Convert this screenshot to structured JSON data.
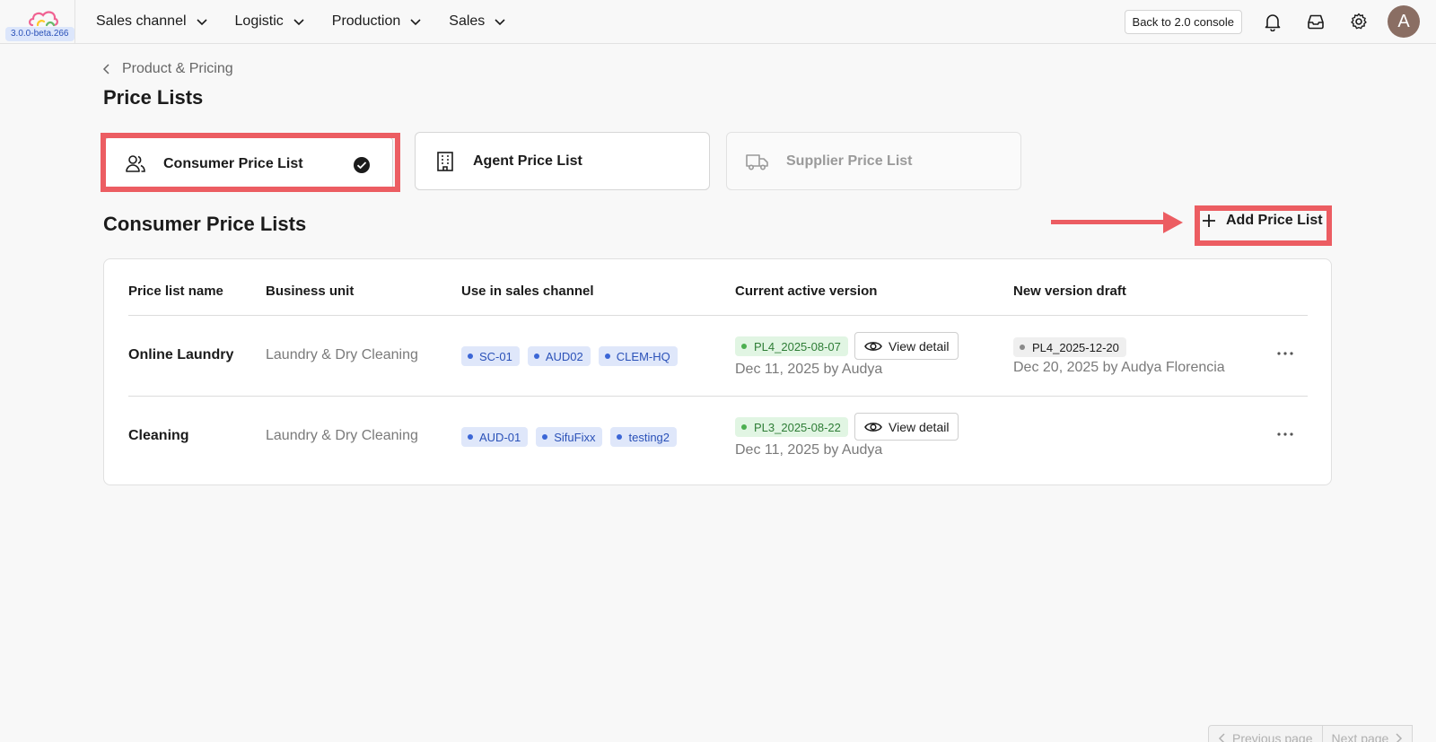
{
  "app": {
    "version": "3.0.0-beta.266"
  },
  "nav": {
    "items": [
      {
        "label": "Sales channel"
      },
      {
        "label": "Logistic"
      },
      {
        "label": "Production"
      },
      {
        "label": "Sales"
      }
    ]
  },
  "topbar": {
    "back_label": "Back to 2.0 console",
    "avatar_initial": "A"
  },
  "breadcrumb": {
    "parent": "Product & Pricing"
  },
  "page": {
    "title": "Price Lists"
  },
  "price_types": [
    {
      "label": "Consumer Price List",
      "icon": "users-icon",
      "selected": true
    },
    {
      "label": "Agent Price List",
      "icon": "building-icon",
      "selected": false
    },
    {
      "label": "Supplier Price List",
      "icon": "truck-icon",
      "selected": false,
      "disabled": true
    }
  ],
  "section": {
    "title": "Consumer Price Lists",
    "add_label": "Add Price List"
  },
  "table": {
    "headers": [
      "Price list name",
      "Business unit",
      "Use in sales channel",
      "Current active version",
      "New version draft"
    ],
    "rows": [
      {
        "name": "Online Laundry",
        "business_unit": "Laundry & Dry Cleaning",
        "channels": [
          "SC-01",
          "AUD02",
          "CLEM-HQ"
        ],
        "active_version": "PL4_2025-08-07",
        "active_meta": "Dec 11, 2025 by Audya",
        "view_label": "View detail",
        "draft_version": "PL4_2025-12-20",
        "draft_meta": "Dec 20, 2025 by Audya Florencia"
      },
      {
        "name": "Cleaning",
        "business_unit": "Laundry & Dry Cleaning",
        "channels": [
          "AUD-01",
          "SifuFixx",
          "testing2"
        ],
        "active_version": "PL3_2025-08-22",
        "active_meta": "Dec 11, 2025 by Audya",
        "view_label": "View detail"
      }
    ]
  },
  "pagination": {
    "prev_label": "Previous page",
    "next_label": "Next page"
  },
  "colors": {
    "highlight": "#ec5d62",
    "channel_chip": "#dfe7fa",
    "version_chip": "#e1f5e3"
  }
}
